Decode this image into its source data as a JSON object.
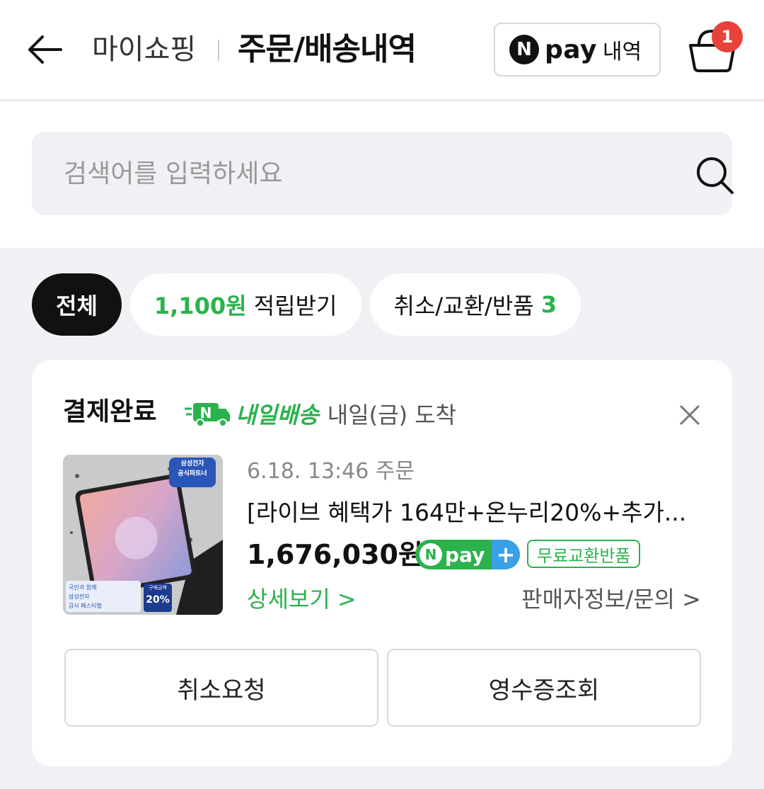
{
  "header": {
    "breadcrumb": "마이쇼핑",
    "title": "주문/배송내역",
    "npay_label": "pay",
    "npay_sub": "내역",
    "npay_logo": "N",
    "cart_count": "1"
  },
  "search": {
    "placeholder": "검색어를 입력하세요",
    "value": ""
  },
  "chips": [
    {
      "label": "전체"
    },
    {
      "highlight": "1,100원",
      "label": " 적립받기"
    },
    {
      "label": "취소/교환/반품 ",
      "count": "3"
    }
  ],
  "order": {
    "status": "결제완료",
    "delivery_brand": "내일배송",
    "delivery_eta": "내일(금) 도착",
    "date": "6.18. 13:46 주문",
    "product_name": "[라이브 혜택가 164만+온누리20%+추가...",
    "price": "1,676,030원",
    "npay_plus": "pay",
    "npay_plus_symbol": "+",
    "free_return_badge": "무료교환반품",
    "detail_link": "상세보기 >",
    "seller_link": "판매자정보/문의 >",
    "thumb_text": {
      "top_badge_line1": "삼성전자",
      "top_badge_line2": "공식파트너",
      "left_badge_line1": "국민과 함께",
      "left_badge_line2": "삼성전자",
      "left_badge_line3": "감사 페스티벌",
      "right_badge_line1": "구매금액",
      "right_badge_line2": "20%"
    }
  },
  "actions": {
    "cancel": "취소요청",
    "receipt": "영수증조회"
  },
  "colors": {
    "accent_green": "#2bb24c",
    "badge_red": "#e8423a",
    "page_bg": "#f0f1f4"
  }
}
